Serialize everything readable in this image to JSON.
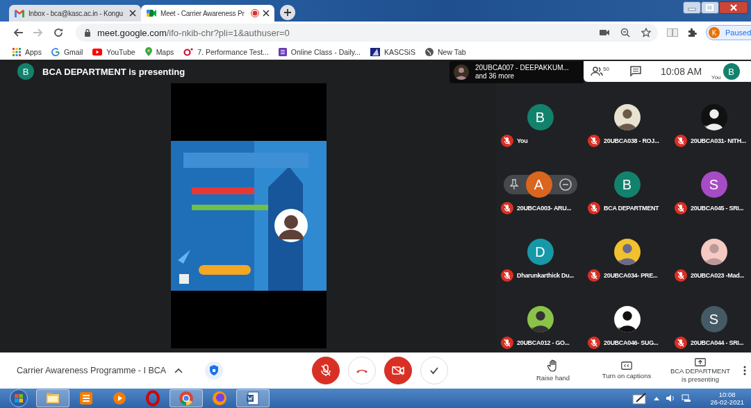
{
  "browser": {
    "tabs": [
      {
        "title": "Inbox - bca@kasc.ac.in - Kongu",
        "selected": false,
        "recording": false
      },
      {
        "title": "Meet - Carrier Awareness Pr",
        "selected": true,
        "recording": true
      }
    ],
    "forward_enabled": false,
    "url_host": "meet.google.com",
    "url_path": "/ifo-nkib-chr?pli=1&authuser=0",
    "profile": {
      "initial": "K",
      "status": "Paused"
    },
    "bookmarks": [
      {
        "label": "Apps"
      },
      {
        "label": "Gmail"
      },
      {
        "label": "YouTube"
      },
      {
        "label": "Maps"
      },
      {
        "label": "7. Performance Test..."
      },
      {
        "label": "Online Class - Daily..."
      },
      {
        "label": "KASCSiS"
      },
      {
        "label": "New Tab"
      }
    ]
  },
  "meeting": {
    "presenter": {
      "initial": "B",
      "text": "BCA DEPARTMENT is presenting"
    },
    "top_bar": {
      "viewer": "20UBCA007 - DEEPAKKUM...",
      "viewer_more": "and 36 more",
      "people_count": "50",
      "time": "10:08 AM",
      "self_label": "You",
      "self_initial": "B"
    },
    "participants": [
      {
        "name": "You",
        "kind": "letter",
        "letter": "B",
        "color": "#12826c",
        "muted": true,
        "hovered": false
      },
      {
        "name": "20UBCA038 - ROJ...",
        "kind": "picture",
        "muted": true,
        "hovered": false
      },
      {
        "name": "20UBCA031- NITH...",
        "kind": "picture",
        "muted": true,
        "hovered": false
      },
      {
        "name": "20UBCA003- ARU...",
        "kind": "letter",
        "letter": "A",
        "color": "#d9651f",
        "muted": true,
        "hovered": true
      },
      {
        "name": "BCA DEPARTMENT",
        "kind": "letter",
        "letter": "B",
        "color": "#12826c",
        "muted": true,
        "hovered": false
      },
      {
        "name": "20UBCA045 - SRI...",
        "kind": "letter",
        "letter": "S",
        "color": "#a64cc4",
        "muted": true,
        "hovered": false
      },
      {
        "name": "Dharunkarthick Du...",
        "kind": "letter",
        "letter": "D",
        "color": "#1798a8",
        "muted": true,
        "hovered": false
      },
      {
        "name": "20UBCA034- PRE...",
        "kind": "picture",
        "muted": true,
        "hovered": false
      },
      {
        "name": "20UBCA023 -Mad...",
        "kind": "picture",
        "muted": true,
        "hovered": false
      },
      {
        "name": "20UBCA012 - GO...",
        "kind": "picture",
        "muted": true,
        "hovered": false
      },
      {
        "name": "20UBCA046- SUG...",
        "kind": "picture",
        "muted": true,
        "hovered": false
      },
      {
        "name": "20UBCA044 - SRI...",
        "kind": "letter",
        "letter": "S",
        "color": "#455a64",
        "muted": true,
        "hovered": false
      }
    ],
    "bottom_bar": {
      "title": "Carrier Awareness Programme - I BCA",
      "mic_muted": true,
      "camera_off": true,
      "actions": [
        {
          "label": "Raise hand"
        },
        {
          "label": "Turn on captions"
        }
      ],
      "presenting": {
        "name": "BCA DEPARTMENT",
        "note": "is presenting"
      }
    }
  },
  "taskbar": {
    "time": "10:08",
    "date": "26-02-2021"
  }
}
